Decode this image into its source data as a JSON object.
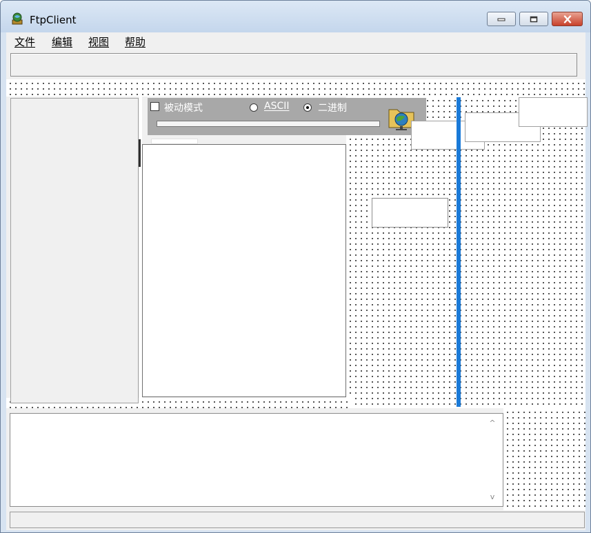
{
  "window": {
    "title": "FtpClient"
  },
  "menu": {
    "items": [
      "文件",
      "编辑",
      "视图",
      "帮助"
    ]
  },
  "options": {
    "passive_mode_label": "被动模式",
    "ascii_label": "ASCII",
    "binary_label": "二进制",
    "passive_checked": false,
    "selected_mode": "binary"
  },
  "log": {
    "scroll_up": "^",
    "scroll_down": "v"
  },
  "colors": {
    "splitter": "#1a7ad8",
    "title_gradient_top": "#dce8f5",
    "close_button": "#c8412b"
  },
  "icons": [
    "ftp-app-icon",
    "minimize-icon",
    "maximize-icon",
    "close-icon",
    "network-folder-icon"
  ]
}
